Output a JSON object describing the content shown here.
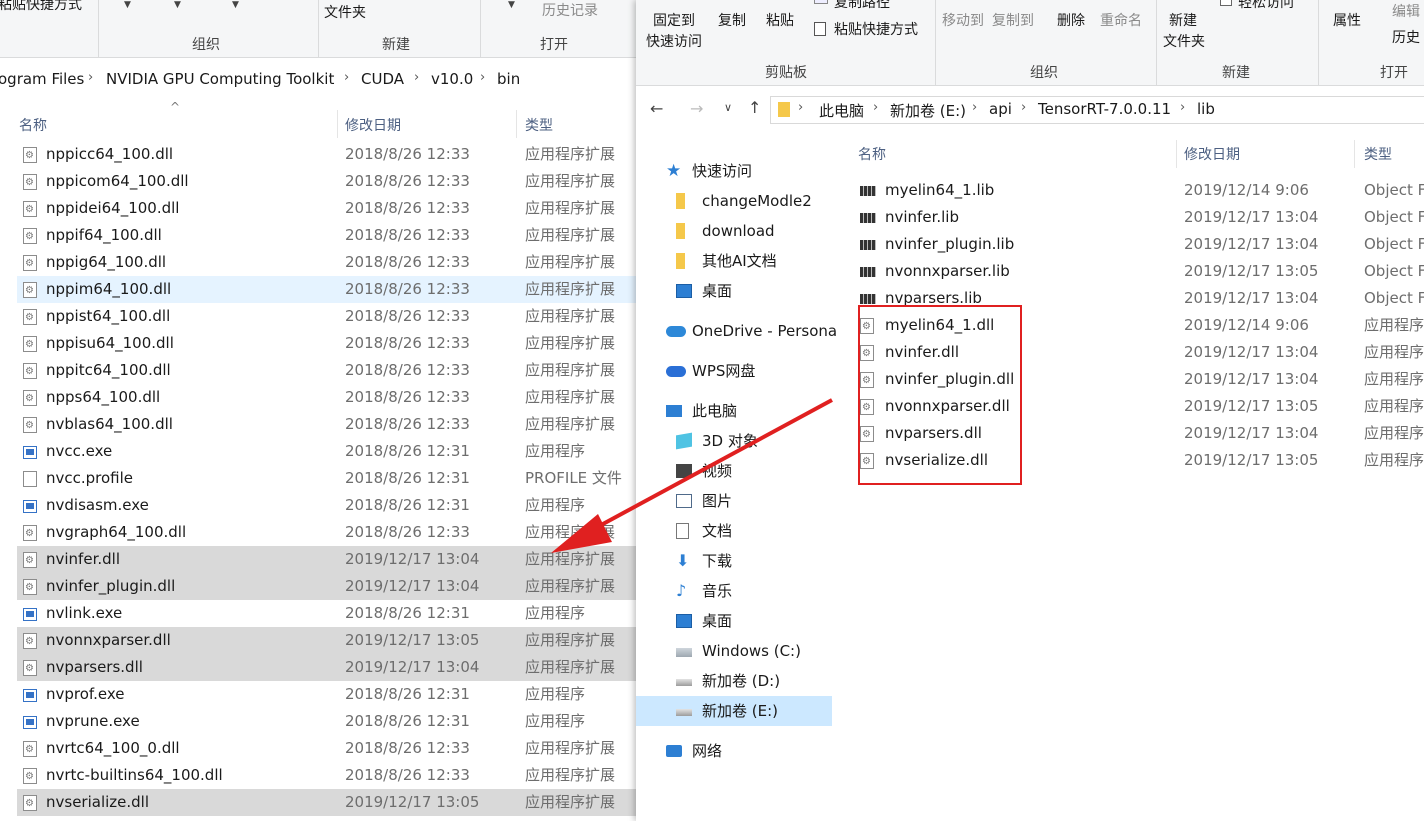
{
  "left": {
    "ribbon": {
      "paste_shortcut": "粘贴快捷方式",
      "history": "历史记录",
      "new_folder_label": "文件夹",
      "group_organize": "组织",
      "group_new": "新建",
      "group_open": "打开"
    },
    "breadcrumb": [
      "ogram Files",
      "NVIDIA GPU Computing Toolkit",
      "CUDA",
      "v10.0",
      "bin"
    ],
    "columns": {
      "name": "名称",
      "date": "修改日期",
      "type": "类型"
    },
    "files": [
      {
        "name": "nppicc64_100.dll",
        "date": "2018/8/26 12:33",
        "type": "应用程序扩展",
        "icon": "dll"
      },
      {
        "name": "nppicom64_100.dll",
        "date": "2018/8/26 12:33",
        "type": "应用程序扩展",
        "icon": "dll"
      },
      {
        "name": "nppidei64_100.dll",
        "date": "2018/8/26 12:33",
        "type": "应用程序扩展",
        "icon": "dll"
      },
      {
        "name": "nppif64_100.dll",
        "date": "2018/8/26 12:33",
        "type": "应用程序扩展",
        "icon": "dll"
      },
      {
        "name": "nppig64_100.dll",
        "date": "2018/8/26 12:33",
        "type": "应用程序扩展",
        "icon": "dll"
      },
      {
        "name": "nppim64_100.dll",
        "date": "2018/8/26 12:33",
        "type": "应用程序扩展",
        "icon": "dll",
        "state": "hover"
      },
      {
        "name": "nppist64_100.dll",
        "date": "2018/8/26 12:33",
        "type": "应用程序扩展",
        "icon": "dll"
      },
      {
        "name": "nppisu64_100.dll",
        "date": "2018/8/26 12:33",
        "type": "应用程序扩展",
        "icon": "dll"
      },
      {
        "name": "nppitc64_100.dll",
        "date": "2018/8/26 12:33",
        "type": "应用程序扩展",
        "icon": "dll"
      },
      {
        "name": "npps64_100.dll",
        "date": "2018/8/26 12:33",
        "type": "应用程序扩展",
        "icon": "dll"
      },
      {
        "name": "nvblas64_100.dll",
        "date": "2018/8/26 12:33",
        "type": "应用程序扩展",
        "icon": "dll"
      },
      {
        "name": "nvcc.exe",
        "date": "2018/8/26 12:31",
        "type": "应用程序",
        "icon": "exe"
      },
      {
        "name": "nvcc.profile",
        "date": "2018/8/26 12:31",
        "type": "PROFILE 文件",
        "icon": "doc"
      },
      {
        "name": "nvdisasm.exe",
        "date": "2018/8/26 12:31",
        "type": "应用程序",
        "icon": "exe"
      },
      {
        "name": "nvgraph64_100.dll",
        "date": "2018/8/26 12:33",
        "type": "应用程序扩展",
        "icon": "dll"
      },
      {
        "name": "nvinfer.dll",
        "date": "2019/12/17 13:04",
        "type": "应用程序扩展",
        "icon": "dll",
        "state": "sel"
      },
      {
        "name": "nvinfer_plugin.dll",
        "date": "2019/12/17 13:04",
        "type": "应用程序扩展",
        "icon": "dll",
        "state": "sel"
      },
      {
        "name": "nvlink.exe",
        "date": "2018/8/26 12:31",
        "type": "应用程序",
        "icon": "exe"
      },
      {
        "name": "nvonnxparser.dll",
        "date": "2019/12/17 13:05",
        "type": "应用程序扩展",
        "icon": "dll",
        "state": "sel"
      },
      {
        "name": "nvparsers.dll",
        "date": "2019/12/17 13:04",
        "type": "应用程序扩展",
        "icon": "dll",
        "state": "sel"
      },
      {
        "name": "nvprof.exe",
        "date": "2018/8/26 12:31",
        "type": "应用程序",
        "icon": "exe"
      },
      {
        "name": "nvprune.exe",
        "date": "2018/8/26 12:31",
        "type": "应用程序",
        "icon": "exe"
      },
      {
        "name": "nvrtc64_100_0.dll",
        "date": "2018/8/26 12:33",
        "type": "应用程序扩展",
        "icon": "dll"
      },
      {
        "name": "nvrtc-builtins64_100.dll",
        "date": "2018/8/26 12:33",
        "type": "应用程序扩展",
        "icon": "dll"
      },
      {
        "name": "nvserialize.dll",
        "date": "2019/12/17 13:05",
        "type": "应用程序扩展",
        "icon": "dll",
        "state": "sel"
      }
    ]
  },
  "right": {
    "ribbon": {
      "pin_quick_access_1": "固定到",
      "pin_quick_access_2": "快速访问",
      "copy": "复制",
      "paste": "粘贴",
      "copy_path": "复制路径",
      "paste_shortcut": "粘贴快捷方式",
      "move_to": "移动到",
      "copy_to": "复制到",
      "delete": "删除",
      "rename": "重命名",
      "new_folder_1": "新建",
      "new_folder_2": "文件夹",
      "easy_access": "轻松访问",
      "properties": "属性",
      "edit": "编辑",
      "history": "历史",
      "group_clipboard": "剪贴板",
      "group_organize": "组织",
      "group_new": "新建",
      "group_open": "打开"
    },
    "breadcrumb": [
      "此电脑",
      "新加卷 (E:)",
      "api",
      "TensorRT-7.0.0.11",
      "lib"
    ],
    "nav": [
      {
        "label": "快速访问",
        "icon": "star",
        "level": 0
      },
      {
        "label": "changeModle2",
        "icon": "folder-sm",
        "level": 1
      },
      {
        "label": "download",
        "icon": "folder-sm",
        "level": 1
      },
      {
        "label": "其他AI文档",
        "icon": "folder-sm",
        "level": 1
      },
      {
        "label": "桌面",
        "icon": "desk",
        "level": 1
      },
      {
        "label": "OneDrive - Persona",
        "icon": "cloud-blue",
        "level": 0
      },
      {
        "label": "WPS网盘",
        "icon": "cloud-wps",
        "level": 0
      },
      {
        "label": "此电脑",
        "icon": "pc",
        "level": 0
      },
      {
        "label": "3D 对象",
        "icon": "3d",
        "level": 1
      },
      {
        "label": "视频",
        "icon": "video",
        "level": 1
      },
      {
        "label": "图片",
        "icon": "pic",
        "level": 1
      },
      {
        "label": "文档",
        "icon": "doc",
        "level": 1
      },
      {
        "label": "下载",
        "icon": "down",
        "level": 1
      },
      {
        "label": "音乐",
        "icon": "music",
        "level": 1
      },
      {
        "label": "桌面",
        "icon": "desk",
        "level": 1
      },
      {
        "label": "Windows (C:)",
        "icon": "drive-c",
        "level": 1
      },
      {
        "label": "新加卷 (D:)",
        "icon": "drive",
        "level": 1
      },
      {
        "label": "新加卷 (E:)",
        "icon": "drive",
        "level": 1,
        "state": "sel"
      },
      {
        "label": "网络",
        "icon": "net",
        "level": 0
      }
    ],
    "columns": {
      "name": "名称",
      "date": "修改日期",
      "type": "类型"
    },
    "files": [
      {
        "name": "myelin64_1.lib",
        "date": "2019/12/14 9:06",
        "type": "Object F",
        "icon": "lib"
      },
      {
        "name": "nvinfer.lib",
        "date": "2019/12/17 13:04",
        "type": "Object F",
        "icon": "lib"
      },
      {
        "name": "nvinfer_plugin.lib",
        "date": "2019/12/17 13:04",
        "type": "Object F",
        "icon": "lib"
      },
      {
        "name": "nvonnxparser.lib",
        "date": "2019/12/17 13:05",
        "type": "Object F",
        "icon": "lib"
      },
      {
        "name": "nvparsers.lib",
        "date": "2019/12/17 13:04",
        "type": "Object F",
        "icon": "lib"
      },
      {
        "name": "myelin64_1.dll",
        "date": "2019/12/14 9:06",
        "type": "应用程序",
        "icon": "dll"
      },
      {
        "name": "nvinfer.dll",
        "date": "2019/12/17 13:04",
        "type": "应用程序",
        "icon": "dll"
      },
      {
        "name": "nvinfer_plugin.dll",
        "date": "2019/12/17 13:04",
        "type": "应用程序",
        "icon": "dll"
      },
      {
        "name": "nvonnxparser.dll",
        "date": "2019/12/17 13:05",
        "type": "应用程序",
        "icon": "dll"
      },
      {
        "name": "nvparsers.dll",
        "date": "2019/12/17 13:04",
        "type": "应用程序",
        "icon": "dll"
      },
      {
        "name": "nvserialize.dll",
        "date": "2019/12/17 13:05",
        "type": "应用程序",
        "icon": "dll"
      }
    ]
  },
  "annotation": {
    "color": "#e02020"
  }
}
